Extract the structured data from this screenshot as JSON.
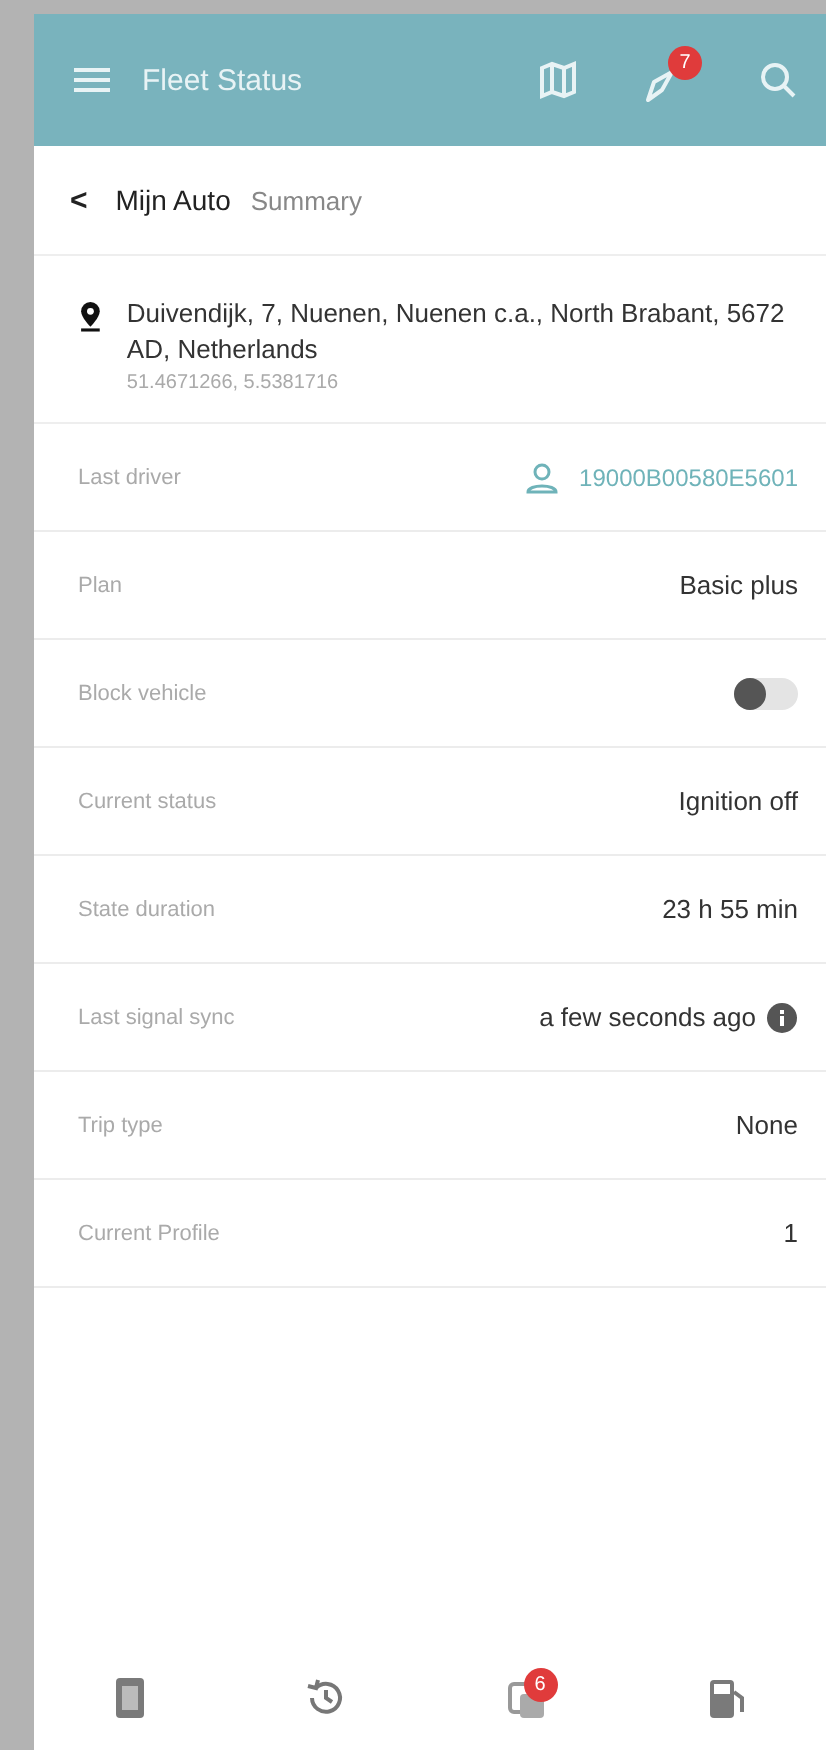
{
  "header": {
    "title": "Fleet Status",
    "alerts_badge": "7"
  },
  "breadcrumb": {
    "back": "<",
    "current": "Mijn Auto",
    "section": "Summary"
  },
  "address": {
    "line": "Duivendijk, 7, Nuenen, Nuenen c.a., North Brabant, 5672 AD, Netherlands",
    "coordinates": "51.4671266, 5.5381716"
  },
  "rows": [
    {
      "kind": "driver",
      "label": "Last driver",
      "value": "19000B00580E5601"
    },
    {
      "kind": "text",
      "label": "Plan",
      "value": "Basic plus"
    },
    {
      "kind": "toggle",
      "label": "Block vehicle",
      "on": false
    },
    {
      "kind": "text",
      "label": "Current status",
      "value": "Ignition off"
    },
    {
      "kind": "text",
      "label": "State duration",
      "value": "23 h 55 min"
    },
    {
      "kind": "info",
      "label": "Last signal sync",
      "value": "a few seconds ago"
    },
    {
      "kind": "text",
      "label": "Trip type",
      "value": "None"
    },
    {
      "kind": "text",
      "label": "Current Profile",
      "value": "1"
    }
  ],
  "bottom_nav": [
    {
      "kind": "document"
    },
    {
      "kind": "history"
    },
    {
      "kind": "events",
      "badge": "6"
    },
    {
      "kind": "fuel"
    }
  ]
}
